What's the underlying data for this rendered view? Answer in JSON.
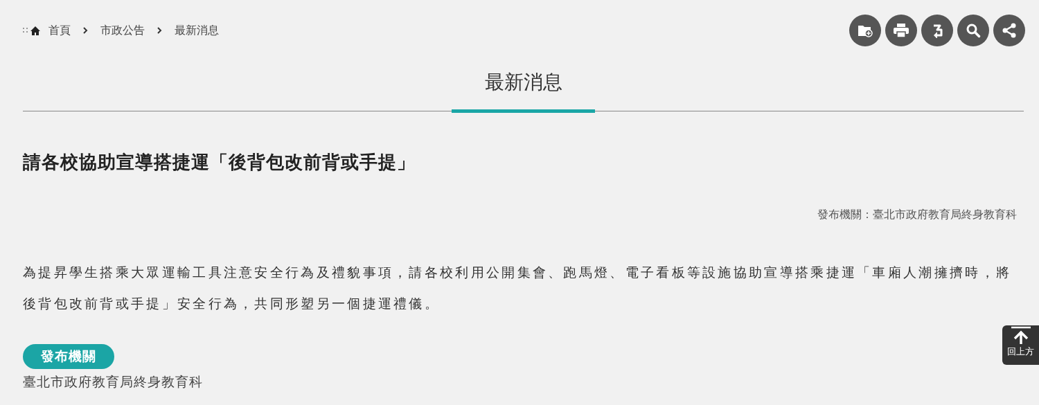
{
  "breadcrumb": [
    "首頁",
    "市政公告",
    "最新消息"
  ],
  "page_title": "最新消息",
  "article": {
    "title": "請各校協助宣導搭捷運「後背包改前背或手提」",
    "publisher_line": "發布機關：臺北市政府教育局終身教育科",
    "body": "為提昇學生搭乘大眾運輸工具注意安全行為及禮貌事項，請各校利用公開集會、跑馬燈、電子看板等設施協助宣導搭乘捷運「車廂人潮擁擠時，將後背包改前背或手提」安全行為，共同形塑另一個捷運禮儀。",
    "info": [
      {
        "badge": "發布機關",
        "value": "臺北市政府教育局終身教育科"
      }
    ]
  },
  "back_to_top": {
    "label": "回上方"
  }
}
